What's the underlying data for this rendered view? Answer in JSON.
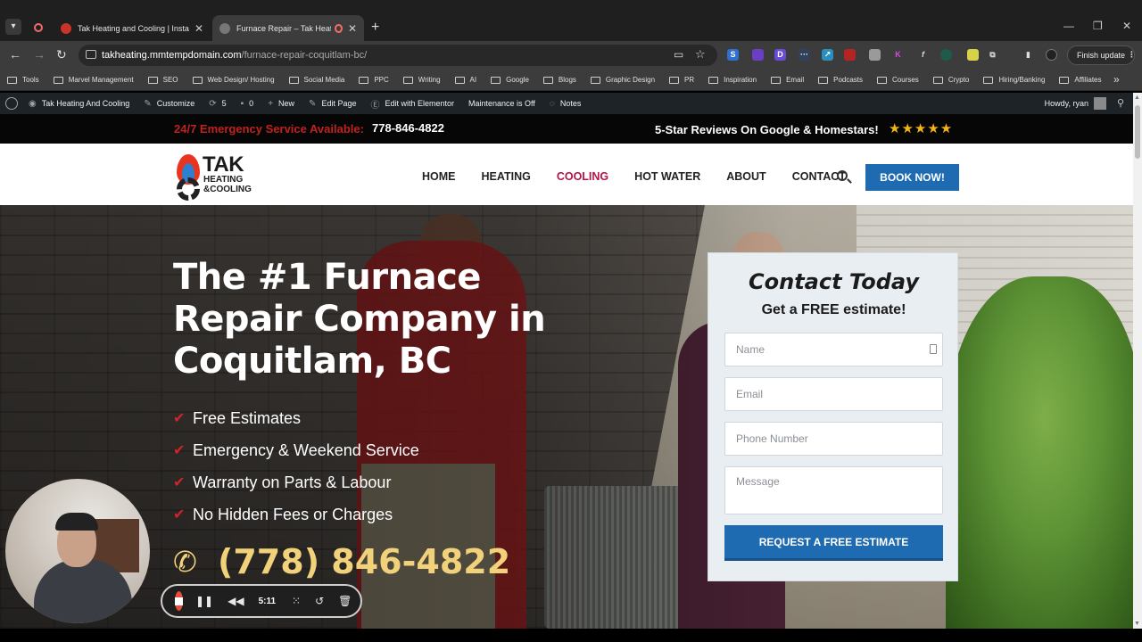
{
  "browser": {
    "tabs": [
      {
        "title": "Tak Heating and Cooling | Installati",
        "active": false
      },
      {
        "title": "Furnace Repair – Tak Heating",
        "active": true
      }
    ],
    "url_host": "takheating.mmtempdomain.com",
    "url_path": "/furnace-repair-coquitlam-bc/",
    "finish_update": "Finish update",
    "bookmarks": [
      "Tools",
      "Marvel Management",
      "SEO",
      "Web Design/ Hosting",
      "Social Media",
      "PPC",
      "Writing",
      "AI",
      "Google",
      "Blogs",
      "Graphic Design",
      "PR",
      "Inspiration",
      "Email",
      "Podcasts",
      "Courses",
      "Crypto",
      "Hiring/Banking",
      "Affiliates"
    ]
  },
  "admin_bar": {
    "site_name": "Tak Heating And Cooling",
    "customize": "Customize",
    "updates": "5",
    "comments": "0",
    "new": "New",
    "edit_page": "Edit Page",
    "elementor": "Edit with Elementor",
    "maintenance": "Maintenance is Off",
    "notes": "Notes",
    "howdy": "Howdy, ryan"
  },
  "topbar": {
    "emergency_label": "24/7 Emergency Service Available:",
    "emergency_phone": "778-846-4822",
    "reviews": "5-Star Reviews On Google & Homestars!",
    "stars": "★★★★★",
    "star_color": "#f3b418"
  },
  "header": {
    "logo_line1": "TAK",
    "logo_line2": "HEATING",
    "logo_line3": "&COOLING",
    "nav": [
      "HOME",
      "HEATING",
      "COOLING",
      "HOT WATER",
      "ABOUT",
      "CONTACT"
    ],
    "active_nav": "COOLING",
    "book_button": "BOOK NOW!",
    "accent": "#1f6bb1"
  },
  "hero": {
    "title": "The #1 Furnace Repair Company in Coquitlam, BC",
    "bullets": [
      "Free Estimates",
      "Emergency & Weekend Service",
      "Warranty on Parts & Labour",
      "No Hidden Fees or Charges"
    ],
    "phone": "(778) 846-4822"
  },
  "form": {
    "title": "Contact Today",
    "subtitle": "Get a FREE estimate!",
    "name_placeholder": "Name",
    "email_placeholder": "Email",
    "phone_placeholder": "Phone Number",
    "message_placeholder": "Message",
    "submit": "REQUEST A FREE ESTIMATE"
  },
  "recorder": {
    "time": "5:11"
  }
}
